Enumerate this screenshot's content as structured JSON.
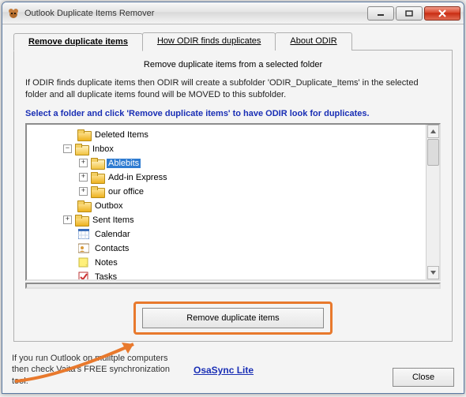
{
  "window": {
    "title": "Outlook Duplicate Items Remover"
  },
  "tabs": {
    "t0": "Remove duplicate items",
    "t1": "How ODIR finds duplicates",
    "t2": "About ODIR"
  },
  "panel": {
    "heading": "Remove duplicate items from a selected folder",
    "body": "If ODIR finds duplicate items then ODIR will create a subfolder 'ODIR_Duplicate_Items' in the selected folder and all duplicate items found will be MOVED to this subfolder.",
    "instruction": "Select a folder and click 'Remove duplicate items' to have ODIR look for duplicates."
  },
  "tree": {
    "deleted": "Deleted Items",
    "inbox": "Inbox",
    "ablebits": "Ablebits",
    "addin": "Add-in Express",
    "ouroffice": "our office",
    "outbox": "Outbox",
    "sent": "Sent Items",
    "calendar": "Calendar",
    "contacts": "Contacts",
    "notes": "Notes",
    "tasks": "Tasks"
  },
  "buttons": {
    "action": "Remove duplicate items",
    "close": "Close"
  },
  "footer": {
    "text": "If you run Outlook on mulitple computers then check Vaita's FREE synchronization tool:",
    "link": "OsaSync Lite"
  }
}
